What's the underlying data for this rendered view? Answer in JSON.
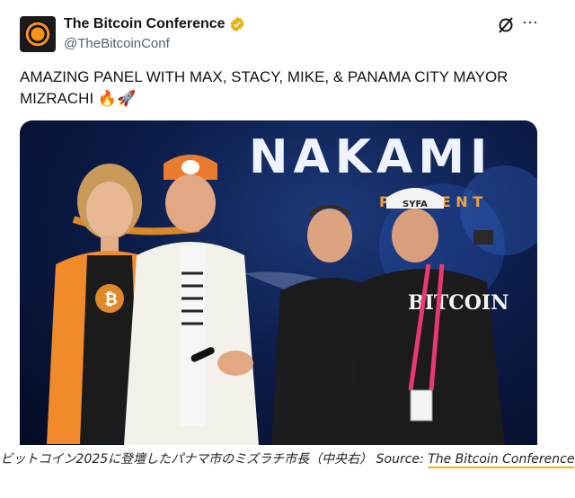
{
  "tweet": {
    "display_name": "The Bitcoin Conference",
    "handle": "@TheBitcoinConf",
    "verified_color": "#e8b00f",
    "text": "AMAZING PANEL WITH MAX, STACY, MIKE, & PANAMA CITY MAYOR MIZRACHI",
    "emojis": "🔥🚀"
  },
  "photo": {
    "stage_banner_text": "NAKAMI",
    "banner_subtext": "P R E S E N T",
    "shirt_text": "BITCOIN",
    "cap_text": "SYFA"
  },
  "caption": {
    "text": "ビットコイン2025に登壇したパナマ市のミズラチ市長（中央右） Source: ",
    "source_link": "The Bitcoin Conference",
    "link_underline_color": "#f2b600"
  }
}
